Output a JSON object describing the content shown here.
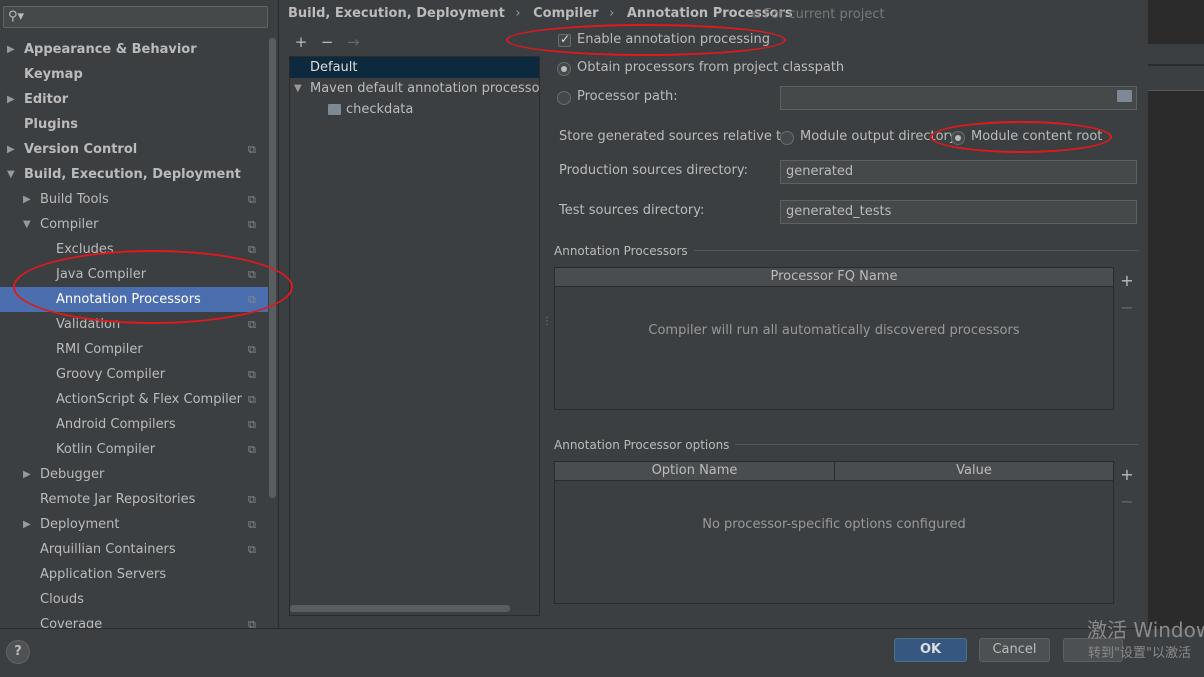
{
  "search": {
    "icon": "search-icon"
  },
  "sidebar": {
    "items": [
      {
        "label": "Appearance & Behavior",
        "arrow": "▶",
        "bold": true,
        "project": false
      },
      {
        "label": "Keymap",
        "arrow": "",
        "bold": true,
        "project": false
      },
      {
        "label": "Editor",
        "arrow": "▶",
        "bold": true,
        "project": false
      },
      {
        "label": "Plugins",
        "arrow": "",
        "bold": true,
        "project": false
      },
      {
        "label": "Version Control",
        "arrow": "▶",
        "bold": true,
        "project": true
      },
      {
        "label": "Build, Execution, Deployment",
        "arrow": "▼",
        "bold": true,
        "project": false
      },
      {
        "label": "Build Tools",
        "arrow": "▶",
        "bold": false,
        "project": true
      },
      {
        "label": "Compiler",
        "arrow": "▼",
        "bold": false,
        "project": true
      },
      {
        "label": "Excludes",
        "arrow": "",
        "bold": false,
        "project": true
      },
      {
        "label": "Java Compiler",
        "arrow": "",
        "bold": false,
        "project": true
      },
      {
        "label": "Annotation Processors",
        "arrow": "",
        "bold": false,
        "project": true,
        "selected": true
      },
      {
        "label": "Validation",
        "arrow": "",
        "bold": false,
        "project": true
      },
      {
        "label": "RMI Compiler",
        "arrow": "",
        "bold": false,
        "project": true
      },
      {
        "label": "Groovy Compiler",
        "arrow": "",
        "bold": false,
        "project": true
      },
      {
        "label": "ActionScript & Flex Compiler",
        "arrow": "",
        "bold": false,
        "project": true
      },
      {
        "label": "Android Compilers",
        "arrow": "",
        "bold": false,
        "project": true
      },
      {
        "label": "Kotlin Compiler",
        "arrow": "",
        "bold": false,
        "project": true
      },
      {
        "label": "Debugger",
        "arrow": "▶",
        "bold": false,
        "project": false
      },
      {
        "label": "Remote Jar Repositories",
        "arrow": "",
        "bold": false,
        "project": true
      },
      {
        "label": "Deployment",
        "arrow": "▶",
        "bold": false,
        "project": true
      },
      {
        "label": "Arquillian Containers",
        "arrow": "",
        "bold": false,
        "project": true
      },
      {
        "label": "Application Servers",
        "arrow": "",
        "bold": false,
        "project": false
      },
      {
        "label": "Clouds",
        "arrow": "",
        "bold": false,
        "project": false
      },
      {
        "label": "Coverage",
        "arrow": "",
        "bold": false,
        "project": true
      }
    ]
  },
  "breadcrumb": {
    "items": [
      "Build, Execution, Deployment",
      "Compiler",
      "Annotation Processors"
    ],
    "separator": "›",
    "for_project": "For current project"
  },
  "profiles": {
    "toolbar": {
      "add": "+",
      "remove": "−",
      "move": "→"
    },
    "rows": [
      "Default",
      "Maven default annotation processors p",
      "checkdata"
    ],
    "expand_arrow": "▼"
  },
  "config": {
    "enable_label": "Enable annotation processing",
    "obtain_classpath_label": "Obtain processors from project classpath",
    "processor_path_label": "Processor path:",
    "processor_path_value": "",
    "store_label": "Store generated sources relative to:",
    "module_output_label": "Module output directory",
    "module_content_label": "Module content root",
    "production_label": "Production sources directory:",
    "production_value": "generated",
    "test_label": "Test sources directory:",
    "test_value": "generated_tests",
    "processors_section": "Annotation Processors",
    "processors_header": "Processor FQ Name",
    "processors_empty": "Compiler will run all automatically discovered processors",
    "options_section": "Annotation Processor options",
    "options_col1": "Option Name",
    "options_col2": "Value",
    "options_empty": "No processor-specific options configured",
    "add_symbol": "+",
    "remove_symbol": "−"
  },
  "footer": {
    "help": "?",
    "ok": "OK",
    "cancel": "Cancel",
    "watermark_line1": "激活 Window",
    "watermark_line2": "转到\"设置\"以激活"
  },
  "colors": {
    "accent": "#4b6eaf",
    "annotation": "#e0191e"
  }
}
